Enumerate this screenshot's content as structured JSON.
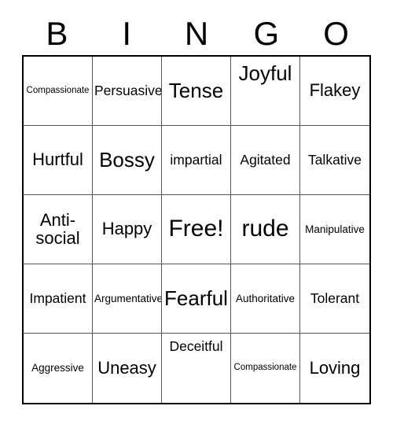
{
  "card": {
    "title_letters": [
      "B",
      "I",
      "N",
      "G",
      "O"
    ],
    "grid_columns": 5,
    "grid_rows": 5,
    "border_color": "#000000",
    "line_color": "#555555",
    "background_color": "#ffffff",
    "text_color": "#000000",
    "free_space": "Free!",
    "cells": [
      [
        {
          "label": "Compassionate",
          "size": "xs",
          "valign": "middle"
        },
        {
          "label": "Persuasive",
          "size": "m",
          "valign": "middle"
        },
        {
          "label": "Tense",
          "size": "xl",
          "valign": "middle"
        },
        {
          "label": "Joyful",
          "size": "xl",
          "valign": "top"
        },
        {
          "label": "Flakey",
          "size": "l",
          "valign": "middle"
        }
      ],
      [
        {
          "label": "Hurtful",
          "size": "l",
          "valign": "middle"
        },
        {
          "label": "Bossy",
          "size": "xl",
          "valign": "middle"
        },
        {
          "label": "impartial",
          "size": "m",
          "valign": "middle"
        },
        {
          "label": "Agitated",
          "size": "m",
          "valign": "middle"
        },
        {
          "label": "Talkative",
          "size": "m",
          "valign": "middle"
        }
      ],
      [
        {
          "label": "Anti-social",
          "size": "l",
          "valign": "middle"
        },
        {
          "label": "Happy",
          "size": "l",
          "valign": "middle"
        },
        {
          "label": "Free!",
          "size": "xxl",
          "valign": "middle"
        },
        {
          "label": "rude",
          "size": "xxl",
          "valign": "middle"
        },
        {
          "label": "Manipulative",
          "size": "s",
          "valign": "middle"
        }
      ],
      [
        {
          "label": "Impatient",
          "size": "m",
          "valign": "middle"
        },
        {
          "label": "Argumentative",
          "size": "s",
          "valign": "middle"
        },
        {
          "label": "Fearful",
          "size": "xl",
          "valign": "middle"
        },
        {
          "label": "Authoritative",
          "size": "s",
          "valign": "middle"
        },
        {
          "label": "Tolerant",
          "size": "m",
          "valign": "middle"
        }
      ],
      [
        {
          "label": "Aggressive",
          "size": "s",
          "valign": "middle"
        },
        {
          "label": "Uneasy",
          "size": "l",
          "valign": "middle"
        },
        {
          "label": "Deceitful",
          "size": "m",
          "valign": "top"
        },
        {
          "label": "Compassionate",
          "size": "xs",
          "valign": "middle"
        },
        {
          "label": "Loving",
          "size": "l",
          "valign": "middle"
        }
      ]
    ]
  }
}
